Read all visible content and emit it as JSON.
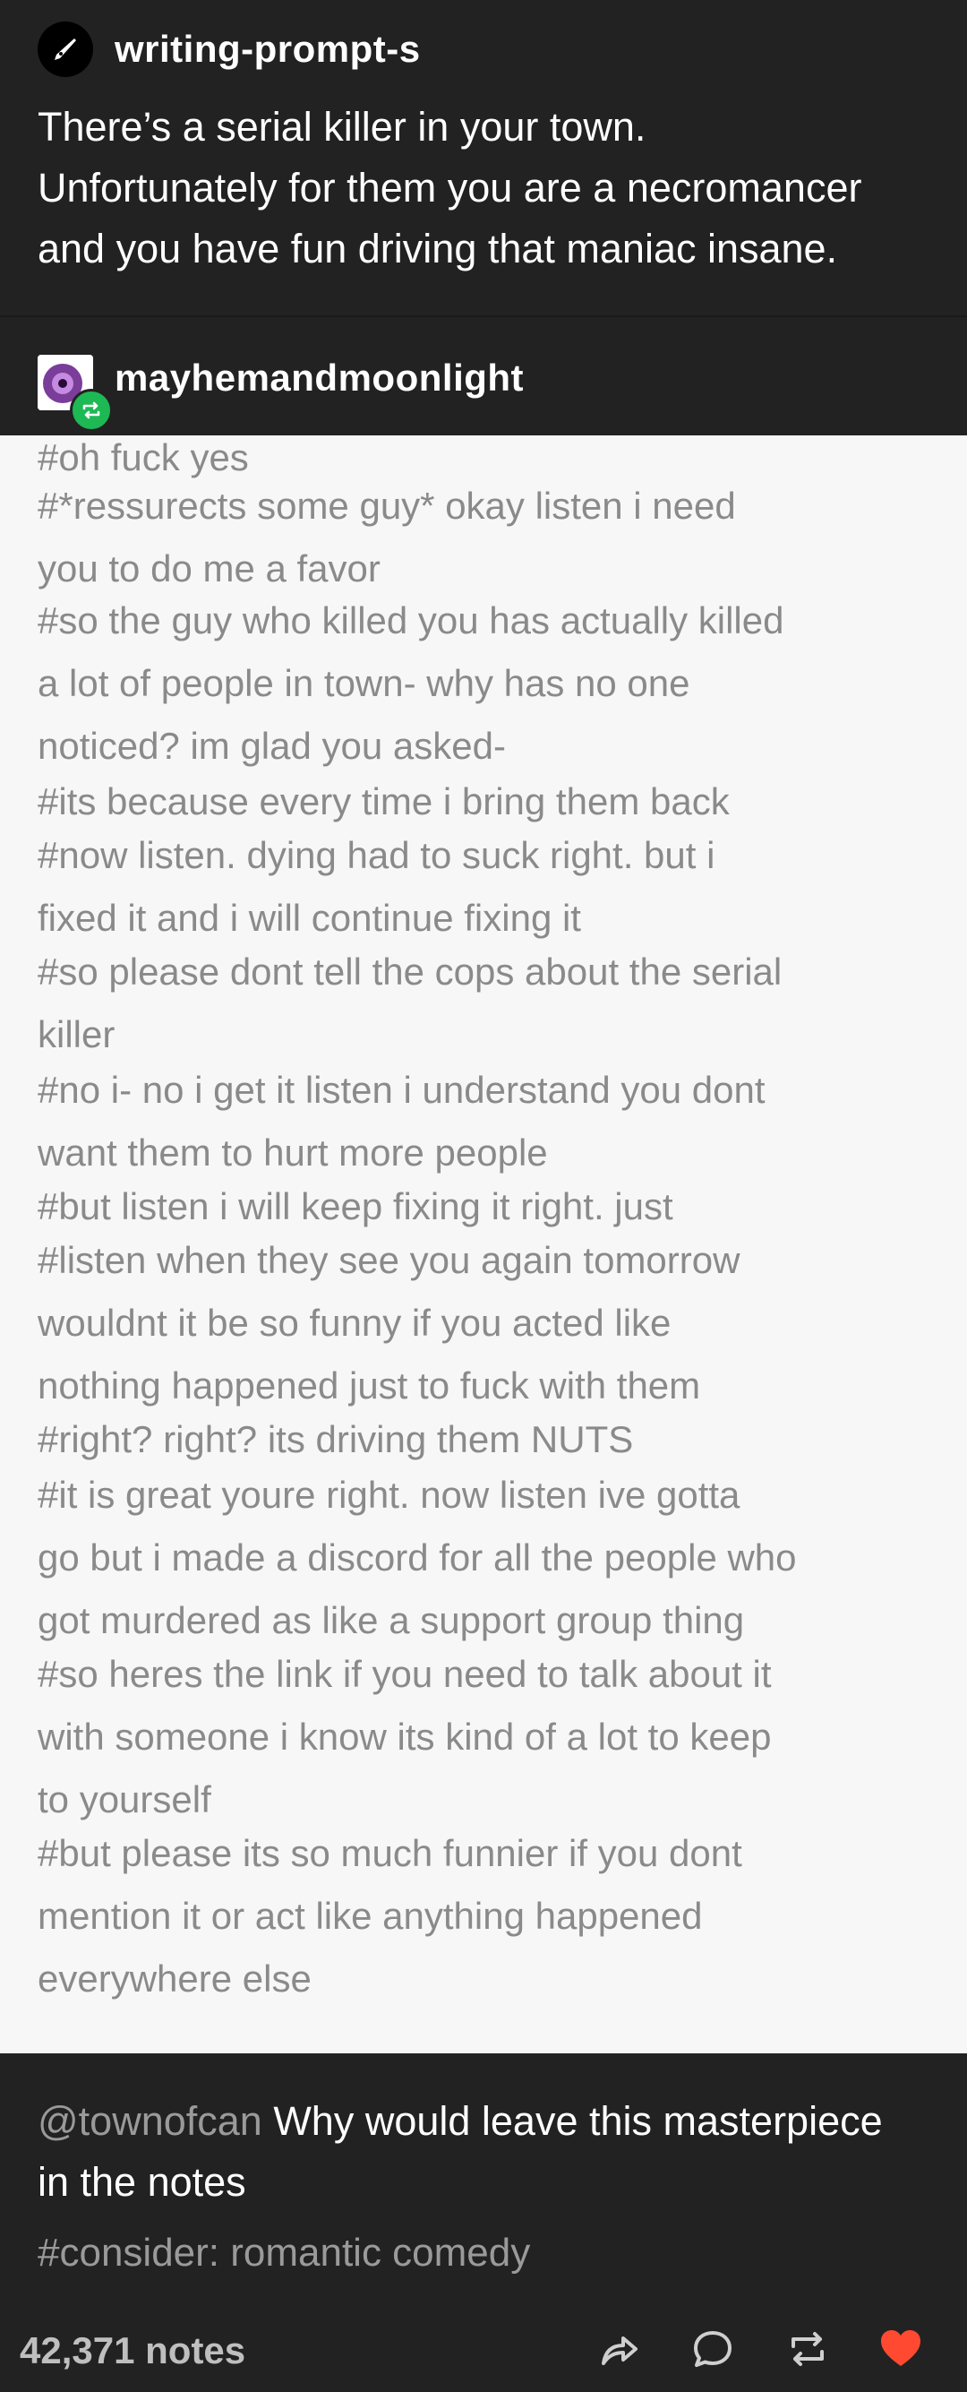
{
  "op": {
    "username": "writing-prompt-s",
    "avatar_icon": "pen-nib-icon",
    "text_lines": [
      "There’s a serial killer in your town.",
      "Unfortunately for them you are a necromancer",
      "and you have fun driving that maniac insane."
    ]
  },
  "reblog": {
    "username": "mayhemandmoonlight",
    "avatar_icon": "purple-eye-avatar",
    "badge_icon": "reblog-icon",
    "tags": [
      "#oh fuck yes",
      "#*ressurects some guy* okay listen i need",
      "you to do me a favor",
      "#so the guy who killed you has actually killed",
      "a lot of people in town- why has no one",
      "noticed? im glad you asked-",
      "#its because every time i bring them back",
      "#now listen. dying had to suck right. but i",
      "fixed it and i will continue fixing it",
      "#so please dont tell the cops about the serial",
      "killer",
      "#no i- no i get it listen i understand you dont",
      "want them to hurt more people",
      "#but listen i will keep fixing it right. just",
      "#listen when they see you again tomorrow",
      "wouldnt it be so funny if you acted like",
      "nothing happened just to fuck with them",
      "#right? right? its driving them NUTS",
      "#it is great youre right. now listen ive gotta",
      "go but i made a discord for all the people who",
      "got murdered as like a support group thing",
      "#so heres the link if you need to talk about it",
      "with someone i know its kind of a lot to keep",
      "to yourself",
      "#but please its so much funnier if you dont",
      "mention it or act like anything happened",
      "everywhere else"
    ]
  },
  "note": {
    "mention": "@townofcan",
    "text_line1": " Why would leave this masterpiece",
    "text_line2": "in the notes",
    "tag": "#consider: romantic comedy"
  },
  "footer": {
    "notes_count": "42,371 notes",
    "icons": [
      "share-icon",
      "reply-icon",
      "reblog-icon",
      "like-heart-icon"
    ],
    "heart_color": "#ff4930"
  },
  "colors": {
    "background": "#222222",
    "tags_panel": "#f7f7f7",
    "tag_text": "#8a8a8a",
    "reblog_badge": "#1db954"
  }
}
